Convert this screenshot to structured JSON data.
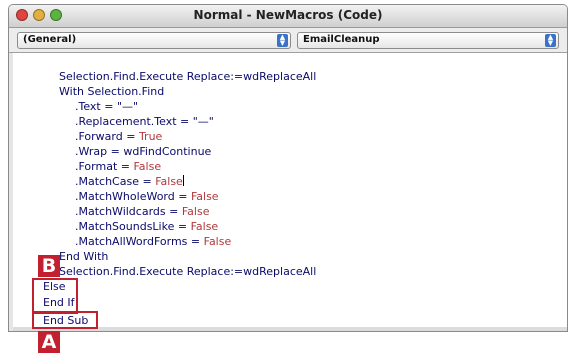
{
  "window": {
    "title": "Normal - NewMacros (Code)",
    "traffic_lights": {
      "close": "#e0443e",
      "minimize": "#e0b040",
      "zoom": "#5cb440"
    }
  },
  "selectors": {
    "object": "(General)",
    "procedure": "EmailCleanup"
  },
  "code": {
    "lines": [
      {
        "prefix": "Selection.Find.Execute Replace:=wdReplaceAll",
        "value": ""
      },
      {
        "prefix": "With Selection.Find",
        "value": ""
      },
      {
        "prefix": ".Text = \"—\"",
        "value": ""
      },
      {
        "prefix": ".Replacement.Text = \"—\"",
        "value": ""
      },
      {
        "prefix": ".Forward = ",
        "value": "True"
      },
      {
        "prefix": ".Wrap = wdFindContinue",
        "value": ""
      },
      {
        "prefix": ".Format = ",
        "value": "False"
      },
      {
        "prefix": ".MatchCase = ",
        "value": "False"
      },
      {
        "prefix": ".MatchWholeWord = ",
        "value": "False"
      },
      {
        "prefix": ".MatchWildcards = ",
        "value": "False"
      },
      {
        "prefix": ".MatchSoundsLike = ",
        "value": "False"
      },
      {
        "prefix": ".MatchAllWordForms = ",
        "value": "False"
      },
      {
        "prefix": "End With",
        "value": ""
      },
      {
        "prefix": "Selection.Find.Execute Replace:=wdReplaceAll",
        "value": ""
      },
      {
        "prefix": "Else",
        "value": ""
      },
      {
        "prefix": "End If",
        "value": ""
      },
      {
        "prefix": "End Sub",
        "value": ""
      }
    ]
  },
  "callouts": {
    "a": "A",
    "b": "B",
    "color": "#c2202e"
  }
}
